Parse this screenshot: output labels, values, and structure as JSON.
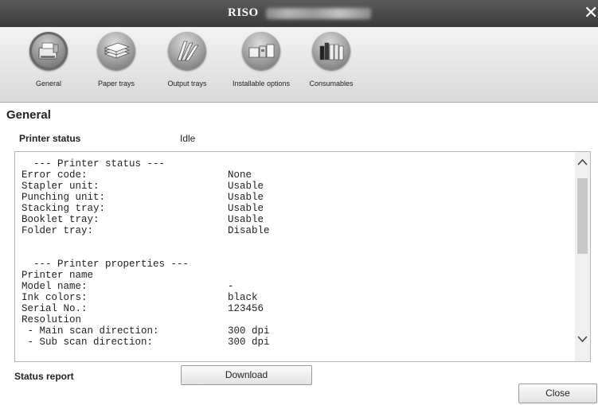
{
  "window": {
    "title": "RISO",
    "close_glyph": "✕"
  },
  "toolbar": {
    "items": [
      {
        "label": "General",
        "icon": "printer-icon",
        "selected": true
      },
      {
        "label": "Paper trays",
        "icon": "paper-stack-icon",
        "selected": false
      },
      {
        "label": "Output trays",
        "icon": "output-tray-icon",
        "selected": false
      },
      {
        "label": "Installable options",
        "icon": "options-icon",
        "selected": false
      },
      {
        "label": "Consumables",
        "icon": "ink-cartridges-icon",
        "selected": false
      }
    ]
  },
  "section": {
    "title": "General"
  },
  "printer_status": {
    "label": "Printer status",
    "value": "Idle"
  },
  "report": {
    "lines": [
      {
        "label": "  --- Printer status ---",
        "value": ""
      },
      {
        "label": "Error code:",
        "value": "None"
      },
      {
        "label": "Stapler unit:",
        "value": "Usable"
      },
      {
        "label": "Punching unit:",
        "value": "Usable"
      },
      {
        "label": "Stacking tray:",
        "value": "Usable"
      },
      {
        "label": "Booklet tray:",
        "value": "Usable"
      },
      {
        "label": "Folder tray:",
        "value": "Disable"
      },
      {
        "label": "",
        "value": ""
      },
      {
        "label": "  --- Printer properties ---",
        "value": ""
      },
      {
        "label": "Printer name",
        "value": ""
      },
      {
        "label": "Model name:",
        "value": "-"
      },
      {
        "label": "Ink colors:",
        "value": "black"
      },
      {
        "label": "Serial No.:",
        "value": "123456"
      },
      {
        "label": "Resolution",
        "value": ""
      },
      {
        "label": " - Main scan direction:",
        "value": "300 dpi"
      },
      {
        "label": " - Sub scan direction:",
        "value": "300 dpi"
      }
    ]
  },
  "status_report": {
    "label": "Status report",
    "download_label": "Download"
  },
  "footer": {
    "close_label": "Close"
  },
  "scrollbar": {
    "up_glyph": "^",
    "down_glyph": "v",
    "position": 0
  }
}
